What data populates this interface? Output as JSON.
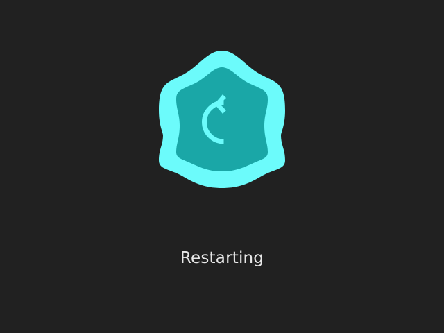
{
  "status": {
    "text": "Restarting"
  },
  "icon": {
    "name": "restart-icon",
    "outer_color": "#6cfbfb",
    "inner_color": "#1aa7a7",
    "glyph_color": "#6cfbfb"
  },
  "colors": {
    "background": "#212121",
    "text": "#e8e8e8"
  }
}
